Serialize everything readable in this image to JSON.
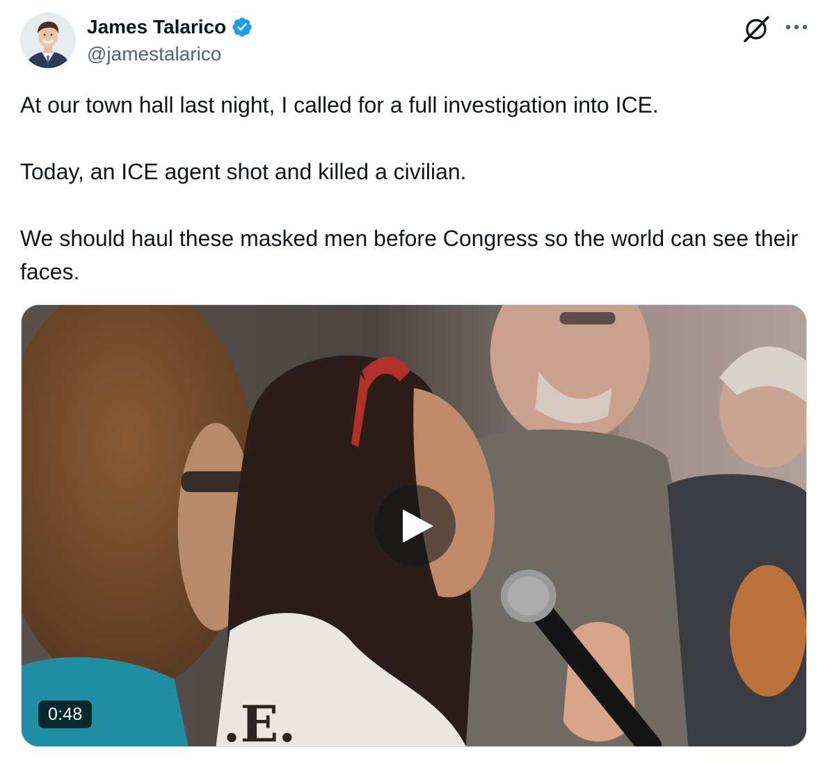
{
  "author": {
    "display_name": "James Talarico",
    "handle": "@jamestalarico",
    "verified": true,
    "verified_color": "#1d9bf0"
  },
  "icons": {
    "avatar": "profile-photo",
    "verified": "verified-badge-icon",
    "grok": "grok-icon",
    "more": "more-options-icon",
    "play": "play-icon"
  },
  "tweet": {
    "paragraphs": [
      "At our town hall last night, I called for a full investigation into ICE.",
      "Today, an ICE agent shot and killed a civilian.",
      "We should haul these masked men before Congress so the world can see their faces."
    ]
  },
  "media": {
    "type": "video",
    "duration": "0:48",
    "shirt_lettering": ".E."
  }
}
